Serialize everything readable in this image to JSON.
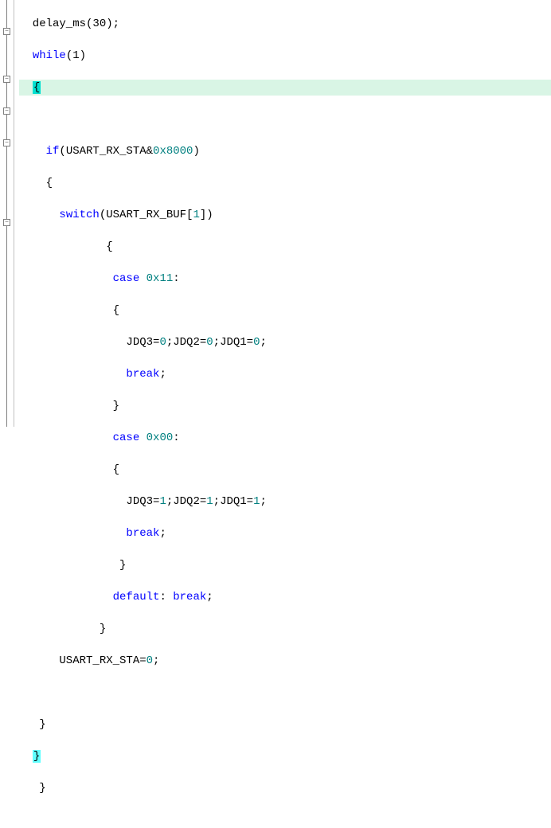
{
  "code": {
    "l0": "  delay_ms(30);",
    "l1_kw": "while",
    "l1_rest": "(1)",
    "l2_brace": "{",
    "l4_kw": "if",
    "l4_a": "(USART_RX_STA&",
    "l4_num": "0x8000",
    "l4_b": ")",
    "l5": "    {",
    "l6_kw": "switch",
    "l6_a": "(USART_RX_BUF[",
    "l6_num": "1",
    "l6_b": "])",
    "l7": "             {",
    "l8_kw": "case",
    "l8_num": "0x11",
    "l8_b": ":",
    "l9": "              {",
    "l10_a": "                JDQ3=",
    "l10_n1": "0",
    "l10_b": ";JDQ2=",
    "l10_n2": "0",
    "l10_c": ";JDQ1=",
    "l10_n3": "0",
    "l10_d": ";",
    "l11_kw": "break",
    "l11_b": ";",
    "l12": "              }",
    "l13_kw": "case",
    "l13_num": "0x00",
    "l13_b": ":",
    "l14": "              {",
    "l15_a": "                JDQ3=",
    "l15_n1": "1",
    "l15_b": ";JDQ2=",
    "l15_n2": "1",
    "l15_c": ";JDQ1=",
    "l15_n3": "1",
    "l15_d": ";",
    "l16_kw": "break",
    "l16_b": ";",
    "l17": "               }",
    "l18_kw1": "default",
    "l18_a": ": ",
    "l18_kw2": "break",
    "l18_b": ";",
    "l19": "            }",
    "l20_a": "      USART_RX_STA=",
    "l20_n": "0",
    "l20_b": ";",
    "l22": "   }",
    "l23_brace": "}",
    "l24": "   }"
  }
}
